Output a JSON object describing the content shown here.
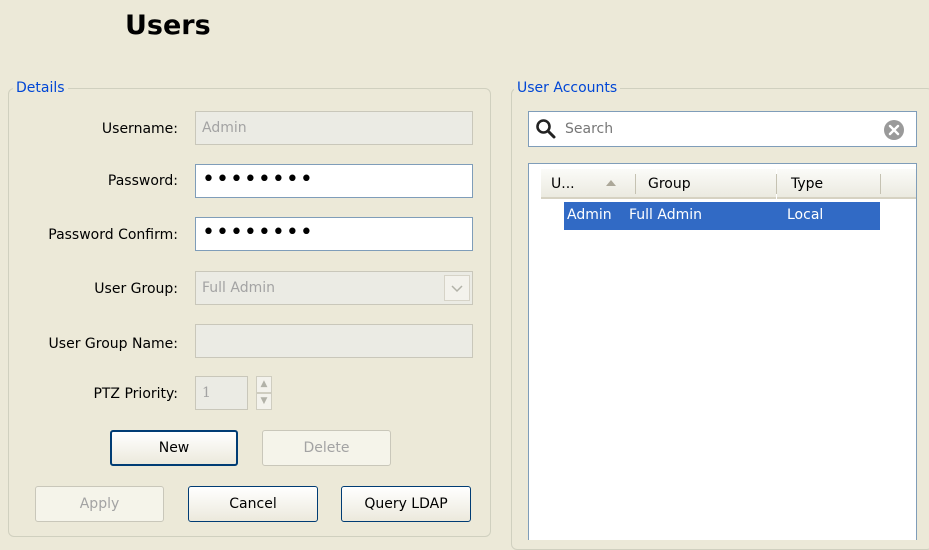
{
  "page": {
    "title": "Users"
  },
  "details": {
    "legend": "Details",
    "username_label": "Username:",
    "username_value": "Admin",
    "password_label": "Password:",
    "password_value": "••••••••",
    "password_confirm_label": "Password Confirm:",
    "password_confirm_value": "••••••••",
    "user_group_label": "User Group:",
    "user_group_value": "Full Admin",
    "user_group_name_label": "User Group Name:",
    "user_group_name_value": "",
    "ptz_priority_label": "PTZ Priority:",
    "ptz_priority_value": "1"
  },
  "buttons": {
    "new": "New",
    "delete": "Delete",
    "apply": "Apply",
    "cancel": "Cancel",
    "query_ldap": "Query LDAP"
  },
  "accounts": {
    "legend": "User Accounts",
    "search_placeholder": "Search",
    "columns": [
      "U...",
      "Group",
      "Type"
    ],
    "sort_column": "U...",
    "rows": [
      {
        "user": "Admin",
        "group": "Full Admin",
        "type": "Local",
        "selected": true
      }
    ]
  },
  "colors": {
    "window_bg": "#ece9d8",
    "legend_text": "#0046d5",
    "selection": "#316ac5",
    "field_border": "#7f9db9",
    "button_border": "#003c74"
  },
  "icons": {
    "search": "magnifier-icon",
    "clear": "clear-x-icon",
    "dropdown": "chevron-down-icon",
    "sort": "sort-up-triangle-icon",
    "spin_up": "spin-up-icon",
    "spin_down": "spin-down-icon"
  }
}
